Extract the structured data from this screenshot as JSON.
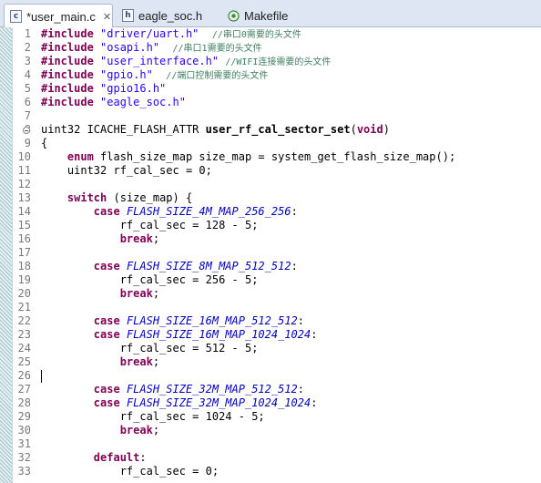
{
  "tabs": [
    {
      "icon": "c-file-icon",
      "glyph": "c",
      "label": "*user_main.c",
      "close": "✕",
      "active": true
    },
    {
      "icon": "h-file-icon",
      "glyph": "h",
      "label": "eagle_soc.h",
      "close": "",
      "active": false
    },
    {
      "icon": "makefile-icon",
      "glyph": "",
      "label": "Makefile",
      "close": "",
      "active": false
    }
  ],
  "fold_marker_line": 8,
  "caret_line": 26,
  "lines": [
    {
      "n": "1",
      "tokens": [
        {
          "t": "#include ",
          "c": "kw"
        },
        {
          "t": "\"driver/uart.h\"",
          "c": "str"
        },
        {
          "t": "  ",
          "c": ""
        },
        {
          "t": "//串口0需要的头文件",
          "c": "cm"
        }
      ]
    },
    {
      "n": "2",
      "tokens": [
        {
          "t": "#include ",
          "c": "kw"
        },
        {
          "t": "\"osapi.h\"",
          "c": "str"
        },
        {
          "t": "  ",
          "c": ""
        },
        {
          "t": "//串口1需要的头文件",
          "c": "cm"
        }
      ]
    },
    {
      "n": "3",
      "tokens": [
        {
          "t": "#include ",
          "c": "kw"
        },
        {
          "t": "\"user_interface.h\"",
          "c": "str"
        },
        {
          "t": " ",
          "c": ""
        },
        {
          "t": "//WIFI连接需要的头文件",
          "c": "cm"
        }
      ]
    },
    {
      "n": "4",
      "tokens": [
        {
          "t": "#include ",
          "c": "kw"
        },
        {
          "t": "\"gpio.h\"",
          "c": "str"
        },
        {
          "t": "  ",
          "c": ""
        },
        {
          "t": "//端口控制需要的头文件",
          "c": "cm"
        }
      ]
    },
    {
      "n": "5",
      "tokens": [
        {
          "t": "#include ",
          "c": "kw"
        },
        {
          "t": "\"gpio16.h\"",
          "c": "str"
        }
      ]
    },
    {
      "n": "6",
      "tokens": [
        {
          "t": "#include ",
          "c": "kw"
        },
        {
          "t": "\"eagle_soc.h\"",
          "c": "str"
        }
      ]
    },
    {
      "n": "7",
      "tokens": []
    },
    {
      "n": "8",
      "tokens": [
        {
          "t": "uint32 ICACHE_FLASH_ATTR ",
          "c": ""
        },
        {
          "t": "user_rf_cal_sector_set",
          "c": "fn"
        },
        {
          "t": "(",
          "c": ""
        },
        {
          "t": "void",
          "c": "kw"
        },
        {
          "t": ")",
          "c": ""
        }
      ]
    },
    {
      "n": "9",
      "tokens": [
        {
          "t": "{",
          "c": ""
        }
      ]
    },
    {
      "n": "10",
      "tokens": [
        {
          "t": "    ",
          "c": ""
        },
        {
          "t": "enum",
          "c": "kw"
        },
        {
          "t": " flash_size_map size_map = system_get_flash_size_map();",
          "c": ""
        }
      ]
    },
    {
      "n": "11",
      "tokens": [
        {
          "t": "    uint32 rf_cal_sec = 0;",
          "c": ""
        }
      ]
    },
    {
      "n": "12",
      "tokens": []
    },
    {
      "n": "13",
      "tokens": [
        {
          "t": "    ",
          "c": ""
        },
        {
          "t": "switch",
          "c": "kw"
        },
        {
          "t": " (size_map) {",
          "c": ""
        }
      ]
    },
    {
      "n": "14",
      "tokens": [
        {
          "t": "        ",
          "c": ""
        },
        {
          "t": "case",
          "c": "kw"
        },
        {
          "t": " ",
          "c": ""
        },
        {
          "t": "FLASH_SIZE_4M_MAP_256_256",
          "c": "mac"
        },
        {
          "t": ":",
          "c": ""
        }
      ]
    },
    {
      "n": "15",
      "tokens": [
        {
          "t": "            rf_cal_sec = 128 - 5;",
          "c": ""
        }
      ]
    },
    {
      "n": "16",
      "tokens": [
        {
          "t": "            ",
          "c": ""
        },
        {
          "t": "break",
          "c": "kw"
        },
        {
          "t": ";",
          "c": ""
        }
      ]
    },
    {
      "n": "17",
      "tokens": []
    },
    {
      "n": "18",
      "tokens": [
        {
          "t": "        ",
          "c": ""
        },
        {
          "t": "case",
          "c": "kw"
        },
        {
          "t": " ",
          "c": ""
        },
        {
          "t": "FLASH_SIZE_8M_MAP_512_512",
          "c": "mac"
        },
        {
          "t": ":",
          "c": ""
        }
      ]
    },
    {
      "n": "19",
      "tokens": [
        {
          "t": "            rf_cal_sec = 256 - 5;",
          "c": ""
        }
      ]
    },
    {
      "n": "20",
      "tokens": [
        {
          "t": "            ",
          "c": ""
        },
        {
          "t": "break",
          "c": "kw"
        },
        {
          "t": ";",
          "c": ""
        }
      ]
    },
    {
      "n": "21",
      "tokens": []
    },
    {
      "n": "22",
      "tokens": [
        {
          "t": "        ",
          "c": ""
        },
        {
          "t": "case",
          "c": "kw"
        },
        {
          "t": " ",
          "c": ""
        },
        {
          "t": "FLASH_SIZE_16M_MAP_512_512",
          "c": "mac"
        },
        {
          "t": ":",
          "c": ""
        }
      ]
    },
    {
      "n": "23",
      "tokens": [
        {
          "t": "        ",
          "c": ""
        },
        {
          "t": "case",
          "c": "kw"
        },
        {
          "t": " ",
          "c": ""
        },
        {
          "t": "FLASH_SIZE_16M_MAP_1024_1024",
          "c": "mac"
        },
        {
          "t": ":",
          "c": ""
        }
      ]
    },
    {
      "n": "24",
      "tokens": [
        {
          "t": "            rf_cal_sec = 512 - 5;",
          "c": ""
        }
      ]
    },
    {
      "n": "25",
      "tokens": [
        {
          "t": "            ",
          "c": ""
        },
        {
          "t": "break",
          "c": "kw"
        },
        {
          "t": ";",
          "c": ""
        }
      ]
    },
    {
      "n": "26",
      "tokens": []
    },
    {
      "n": "27",
      "tokens": [
        {
          "t": "        ",
          "c": ""
        },
        {
          "t": "case",
          "c": "kw"
        },
        {
          "t": " ",
          "c": ""
        },
        {
          "t": "FLASH_SIZE_32M_MAP_512_512",
          "c": "mac"
        },
        {
          "t": ":",
          "c": ""
        }
      ]
    },
    {
      "n": "28",
      "tokens": [
        {
          "t": "        ",
          "c": ""
        },
        {
          "t": "case",
          "c": "kw"
        },
        {
          "t": " ",
          "c": ""
        },
        {
          "t": "FLASH_SIZE_32M_MAP_1024_1024",
          "c": "mac"
        },
        {
          "t": ":",
          "c": ""
        }
      ]
    },
    {
      "n": "29",
      "tokens": [
        {
          "t": "            rf_cal_sec = 1024 - 5;",
          "c": ""
        }
      ]
    },
    {
      "n": "30",
      "tokens": [
        {
          "t": "            ",
          "c": ""
        },
        {
          "t": "break",
          "c": "kw"
        },
        {
          "t": ";",
          "c": ""
        }
      ]
    },
    {
      "n": "31",
      "tokens": []
    },
    {
      "n": "32",
      "tokens": [
        {
          "t": "        ",
          "c": ""
        },
        {
          "t": "default",
          "c": "kw"
        },
        {
          "t": ":",
          "c": ""
        }
      ]
    },
    {
      "n": "33",
      "tokens": [
        {
          "t": "            rf_cal_sec = 0;",
          "c": ""
        }
      ]
    }
  ]
}
